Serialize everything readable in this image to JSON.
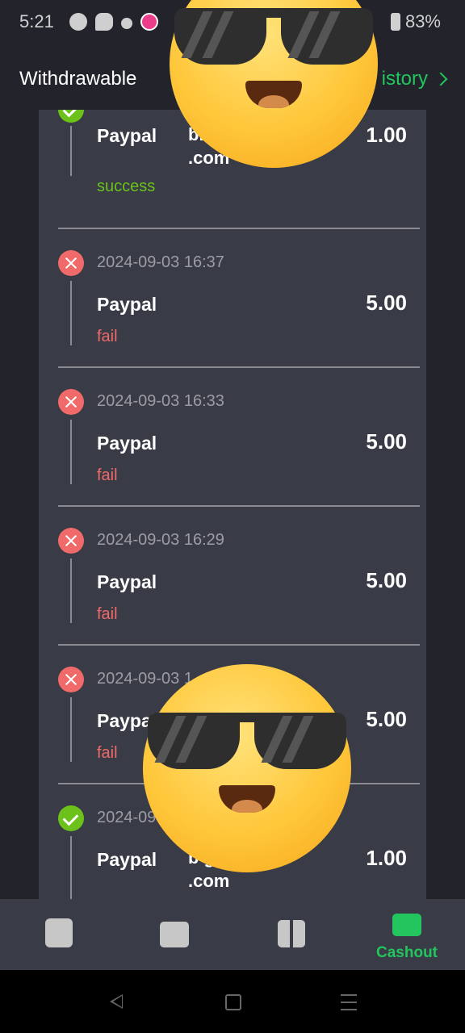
{
  "status_bar": {
    "time": "5:21",
    "battery": "83%"
  },
  "header": {
    "title": "Withdrawable",
    "history_label": "istory"
  },
  "records": [
    {
      "date": "",
      "method": "Paypal",
      "account_line1": "bl",
      "account_line2": ".com",
      "amount": "1.00",
      "result": "success",
      "status": "success"
    },
    {
      "date": "2024-09-03 16:37",
      "method": "Paypal",
      "account_line1": "",
      "account_line2": "",
      "amount": "5.00",
      "result": "fail",
      "status": "fail"
    },
    {
      "date": "2024-09-03 16:33",
      "method": "Paypal",
      "account_line1": "",
      "account_line2": "",
      "amount": "5.00",
      "result": "fail",
      "status": "fail"
    },
    {
      "date": "2024-09-03 16:29",
      "method": "Paypal",
      "account_line1": "",
      "account_line2": "",
      "amount": "5.00",
      "result": "fail",
      "status": "fail"
    },
    {
      "date": "2024-09-03 1",
      "method": "Paypal",
      "account_line1": "",
      "account_line2": "",
      "amount": "5.00",
      "result": "fail",
      "status": "fail"
    },
    {
      "date": "2024-09",
      "method": "Paypal",
      "account_line1": "b               gmail",
      "account_line2": ".com",
      "amount": "1.00",
      "result": "",
      "status": "success"
    }
  ],
  "bottom_nav": {
    "items": [
      {
        "icon": "wallet-icon",
        "label": ""
      },
      {
        "icon": "inbox-icon",
        "label": ""
      },
      {
        "icon": "gift-icon",
        "label": ""
      },
      {
        "icon": "cashout-icon",
        "label": "Cashout"
      }
    ]
  },
  "colors": {
    "accent": "#22c55e",
    "fail": "#f06a6a",
    "success": "#6cc21a",
    "card": "#393b46",
    "background": "#23242b"
  }
}
